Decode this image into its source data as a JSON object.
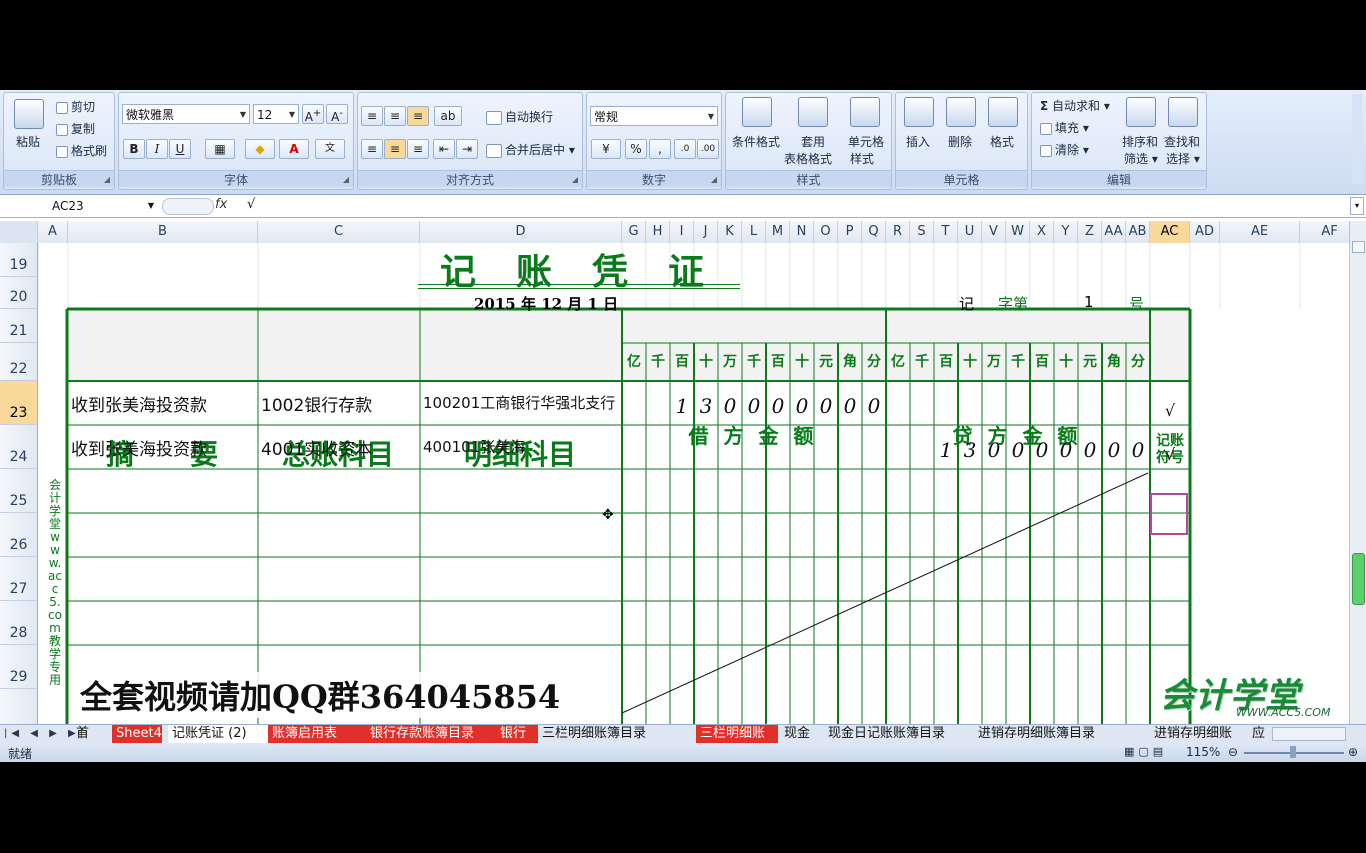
{
  "ribbon": {
    "clipboard": {
      "paste": "粘贴",
      "cut": "剪切",
      "copy": "复制",
      "format_painter": "格式刷",
      "label": "剪贴板"
    },
    "font": {
      "name": "微软雅黑",
      "size": "12",
      "label": "字体",
      "bold": "B",
      "italic": "I",
      "underline": "U"
    },
    "align": {
      "wrap": "自动换行",
      "merge": "合并后居中",
      "label": "对齐方式"
    },
    "number": {
      "format": "常规",
      "percent": "%",
      "comma": ",",
      "label": "数字"
    },
    "styles": {
      "cond": "条件格式",
      "table1": "套用",
      "table2": "表格格式",
      "cell1": "单元格",
      "cell2": "样式",
      "label": "样式"
    },
    "cells": {
      "insert": "插入",
      "delete": "删除",
      "format": "格式",
      "label": "单元格"
    },
    "edit": {
      "autosum": "自动求和",
      "fill": "填充",
      "clear": "清除",
      "sort1": "排序和",
      "sort2": "筛选",
      "find1": "查找和",
      "find2": "选择",
      "label": "编辑"
    }
  },
  "formula": {
    "cell": "AC23",
    "fx": "fx",
    "content": "√"
  },
  "columns": [
    "A",
    "B",
    "C",
    "D",
    "G",
    "H",
    "I",
    "J",
    "K",
    "L",
    "M",
    "N",
    "O",
    "P",
    "Q",
    "R",
    "S",
    "T",
    "U",
    "V",
    "W",
    "X",
    "Y",
    "Z",
    "AA",
    "AB",
    "AC",
    "AD",
    "AE",
    "AF"
  ],
  "rows": [
    "19",
    "20",
    "21",
    "22",
    "23",
    "24",
    "25",
    "26",
    "27",
    "28",
    "29"
  ],
  "voucher": {
    "title": "记　账　凭　证",
    "date": "2015 年  12  月  1  日",
    "no_prefix": "记",
    "no_mid": "字第",
    "no_value": "1",
    "no_suffix": "号",
    "h_summary": "摘　　要",
    "h_account": "总账科目",
    "h_detail": "明细科目",
    "h_debit": "借 方 金 额",
    "h_credit": "贷 方 金 额",
    "h_mark": "记账符号",
    "digits": [
      "亿",
      "千",
      "百",
      "十",
      "万",
      "千",
      "百",
      "十",
      "元",
      "角",
      "分"
    ],
    "entries": [
      {
        "summary": "收到张美海投资款",
        "account": "1002银行存款",
        "detail": "100201工商银行华强北支行",
        "debit": [
          "",
          "",
          "1",
          "3",
          "0",
          "0",
          "0",
          "0",
          "0",
          "0",
          "0"
        ],
        "credit": [
          "",
          "",
          "",
          "",
          "",
          "",
          "",
          "",
          "",
          "",
          ""
        ],
        "mark": "√"
      },
      {
        "summary": "收到张美海投资款",
        "account": "4001实收资本",
        "detail": "400101张美海",
        "debit": [
          "",
          "",
          "",
          "",
          "",
          "",
          "",
          "",
          "",
          "",
          ""
        ],
        "credit": [
          "",
          "",
          "1",
          "3",
          "0",
          "0",
          "0",
          "0",
          "0",
          "0",
          "0"
        ],
        "mark": "√"
      }
    ],
    "side_watermark": "会计学堂www.acc5.com教学专用"
  },
  "overlay": {
    "promo": "全套视频请加QQ群364045854",
    "logo": "会计学堂",
    "logo_url": "WWW.ACC5.COM"
  },
  "tabs": [
    "首页",
    "Sheet4",
    "记账凭证 (2)",
    "账簿启用表",
    "银行存款账簿目录",
    "银行",
    "三栏明细账簿目录",
    "三栏明细账",
    "现金",
    "现金日记账账簿目录",
    "进销存明细账簿目录",
    "进销存明细账",
    "应"
  ],
  "status": {
    "ready": "就绪",
    "zoom": "115%"
  }
}
